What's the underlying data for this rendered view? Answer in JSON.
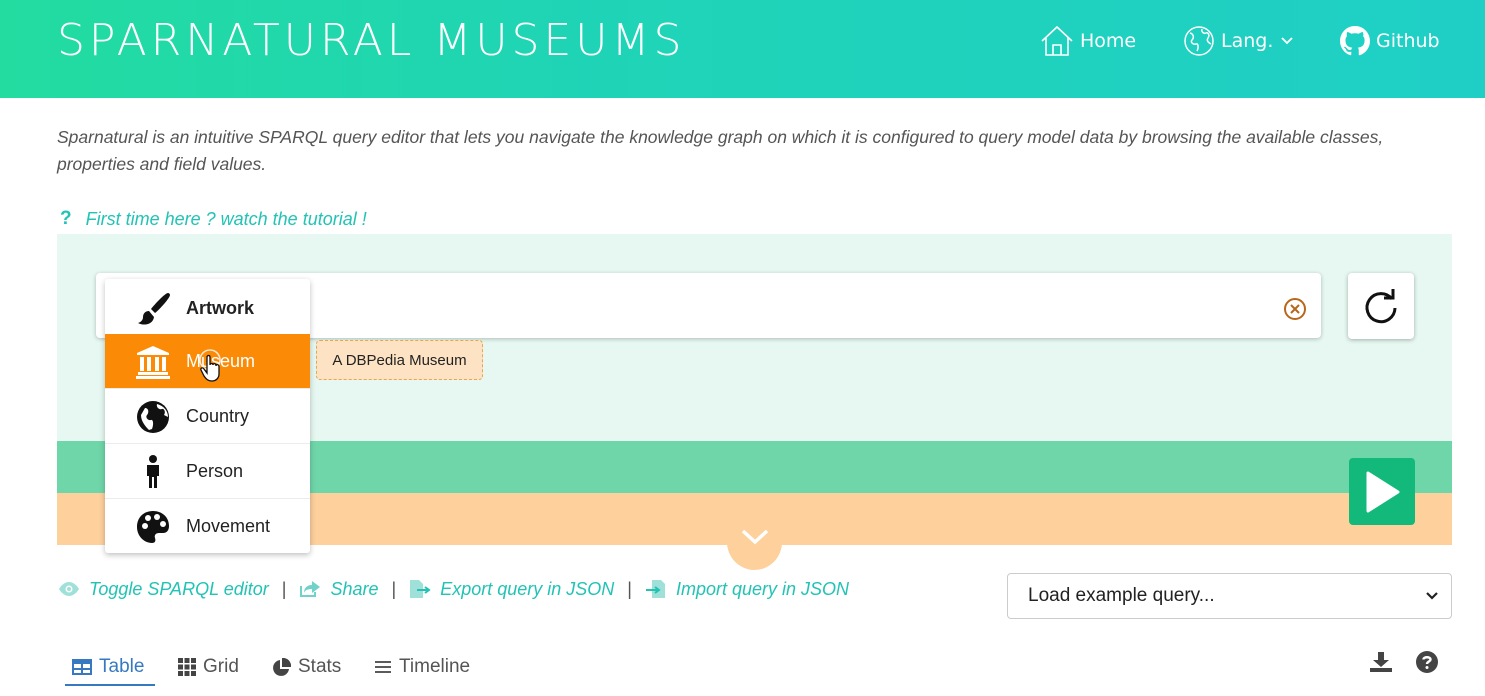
{
  "header": {
    "brand": "SPARNATURAL MUSEUMS",
    "nav": {
      "home": "Home",
      "lang": "Lang.",
      "github": "Github"
    }
  },
  "intro": {
    "text": "Sparnatural is an intuitive SPARQL query editor that lets you navigate the knowledge graph on which it is configured to query model data by browsing the available classes, properties and field values.",
    "tutorial_mark": "?",
    "tutorial_link": "First time here ? watch the tutorial !"
  },
  "dropdown": {
    "items": [
      {
        "label": "Artwork",
        "icon": "brush-icon"
      },
      {
        "label": "Museum",
        "icon": "museum-icon"
      },
      {
        "label": "Country",
        "icon": "globe-icon"
      },
      {
        "label": "Person",
        "icon": "person-icon"
      },
      {
        "label": "Movement",
        "icon": "palette-icon"
      }
    ],
    "active_index": 1
  },
  "tooltip": {
    "text": "A DBPedia Museum"
  },
  "actions": {
    "toggle": "Toggle SPARQL editor",
    "share": "Share",
    "export": "Export query in JSON",
    "import": "Import query in JSON",
    "separator": "|"
  },
  "example_select": {
    "value": "Load example query..."
  },
  "tabs": {
    "table": "Table",
    "grid": "Grid",
    "stats": "Stats",
    "timeline": "Timeline"
  },
  "colors": {
    "header_start": "#22dca0",
    "header_end": "#1fcfc6",
    "accent": "#22c3b5",
    "active_item": "#fb8a06",
    "play": "#13b97b",
    "band_green": "#6fd6a9",
    "band_orange": "#fed09c"
  }
}
